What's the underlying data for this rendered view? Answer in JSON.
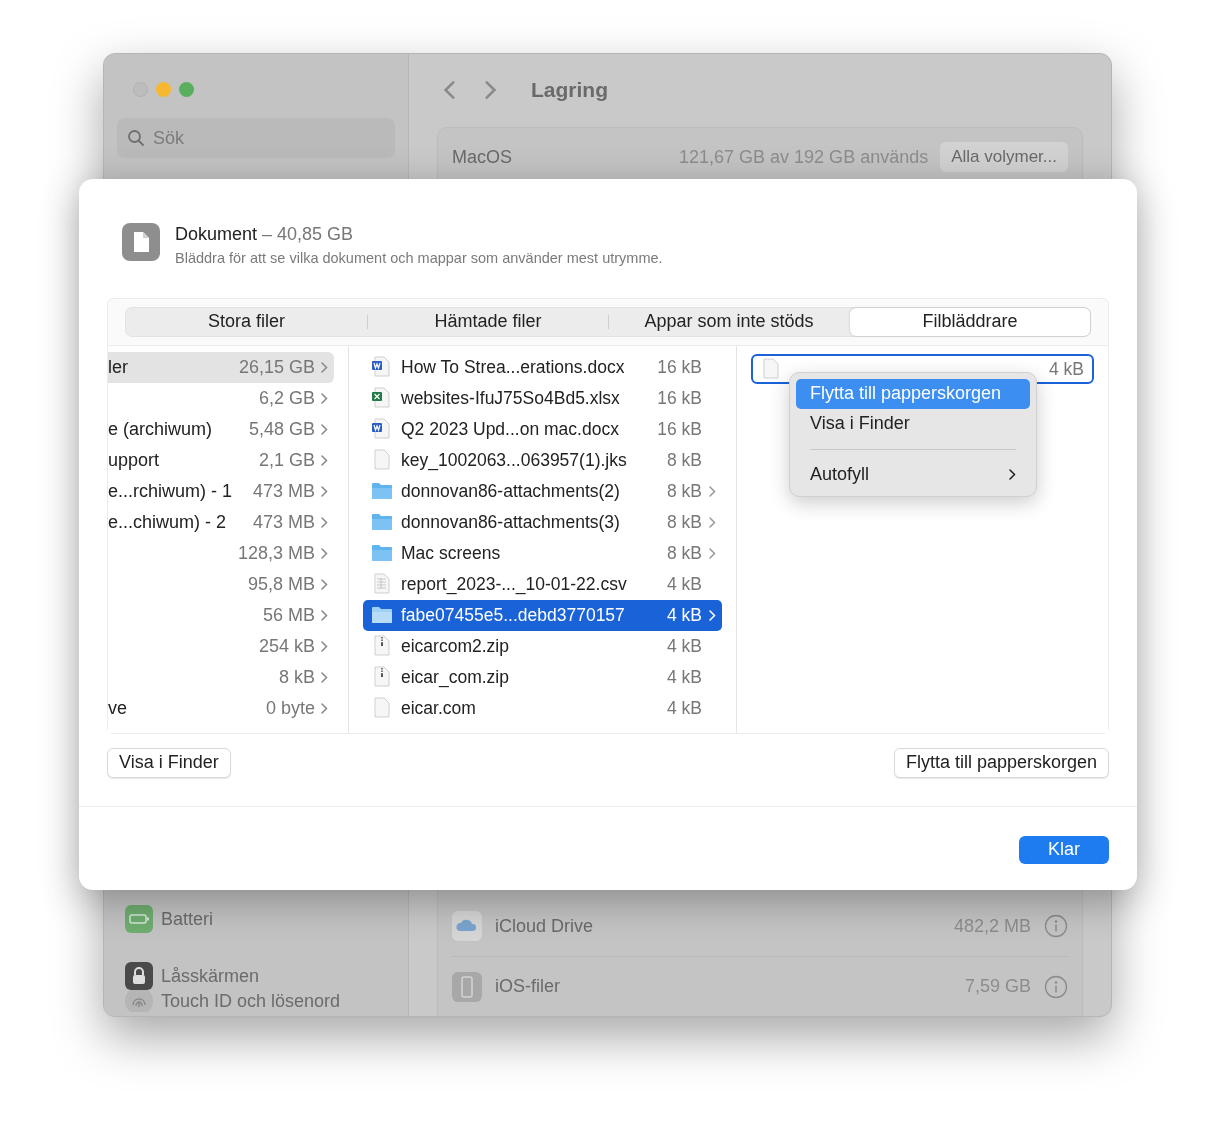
{
  "background_window": {
    "search": {
      "placeholder": "Sök"
    },
    "title": "Lagring",
    "volume": {
      "name": "MacOS",
      "usage": "121,67 GB av 192 GB används",
      "button": "Alla volymer..."
    },
    "sidebar_items": [
      {
        "label": "Batteri",
        "kind": "battery"
      },
      {
        "label": "Låsskärmen",
        "kind": "lock"
      },
      {
        "label": "Touch ID och lösenord",
        "kind": "fingerprint"
      }
    ],
    "storage_rows": [
      {
        "name": "iCloud Drive",
        "size": "482,2 MB",
        "kind": "cloud"
      },
      {
        "name": "iOS-filer",
        "size": "7,59 GB",
        "kind": "phone"
      }
    ]
  },
  "sheet": {
    "title": "Dokument",
    "size": "– 40,85 GB",
    "subtitle": "Bläddra för att se vilka dokument och mappar som använder mest utrymme.",
    "tabs": [
      {
        "label": "Stora filer",
        "selected": false
      },
      {
        "label": "Hämtade filer",
        "selected": false
      },
      {
        "label": "Appar som inte stöds",
        "selected": false
      },
      {
        "label": "Filbläddrare",
        "selected": true
      }
    ],
    "column_1": [
      {
        "name": "ler",
        "size": "26,15 GB",
        "selected": true
      },
      {
        "size": "6,2 GB",
        "selected": false
      },
      {
        "name": "e (archiwum)",
        "size": "5,48 GB",
        "selected": false
      },
      {
        "name": "upport",
        "size": "2,1 GB",
        "selected": false
      },
      {
        "name": "e...rchiwum) - 1",
        "size": "473 MB",
        "selected": false
      },
      {
        "name": "e...chiwum) - 2",
        "size": "473 MB",
        "selected": false
      },
      {
        "size": "128,3 MB",
        "selected": false
      },
      {
        "size": "95,8 MB",
        "selected": false
      },
      {
        "size": "56 MB",
        "selected": false
      },
      {
        "size": "254 kB",
        "selected": false
      },
      {
        "size": "8 kB",
        "selected": false
      },
      {
        "name": "ve",
        "size": "0 byte",
        "selected": false
      }
    ],
    "column_2": [
      {
        "name": "How To Strea...erations.docx",
        "size": "16 kB",
        "kind": "word",
        "selected": false
      },
      {
        "name": "websites-IfuJ75So4Bd5.xlsx",
        "size": "16 kB",
        "kind": "excel",
        "selected": false
      },
      {
        "name": "Q2 2023 Upd...on mac.docx",
        "size": "16 kB",
        "kind": "word",
        "selected": false
      },
      {
        "name": "key_1002063...063957(1).jks",
        "size": "8 kB",
        "kind": "file",
        "selected": false
      },
      {
        "name": "donnovan86-attachments(2)",
        "size": "8 kB",
        "kind": "folder",
        "selected": false
      },
      {
        "name": "donnovan86-attachments(3)",
        "size": "8 kB",
        "kind": "folder",
        "selected": false
      },
      {
        "name": "Mac screens",
        "size": "8 kB",
        "kind": "folder",
        "selected": false
      },
      {
        "name": "report_2023-..._10-01-22.csv",
        "size": "4 kB",
        "kind": "csv",
        "selected": false
      },
      {
        "name": "fabe07455e5...debd3770157",
        "size": "4 kB",
        "kind": "folder",
        "selected": true
      },
      {
        "name": "eicarcom2.zip",
        "size": "4 kB",
        "kind": "zip",
        "selected": false
      },
      {
        "name": "eicar_com.zip",
        "size": "4 kB",
        "kind": "zip",
        "selected": false
      },
      {
        "name": "eicar.com",
        "size": "4 kB",
        "kind": "file",
        "selected": false
      }
    ],
    "column_3": [
      {
        "size": "4 kB",
        "focused": true
      }
    ],
    "context_menu": [
      {
        "label": "Flytta till papperskorgen",
        "selected": true,
        "kind": "item"
      },
      {
        "label": "Visa i Finder",
        "selected": false,
        "kind": "item"
      },
      {
        "label": "Autofyll",
        "selected": false,
        "kind": "submenu"
      }
    ],
    "left_button": "Visa i Finder",
    "right_button": "Flytta till papperskorgen",
    "done_button": "Klar"
  }
}
